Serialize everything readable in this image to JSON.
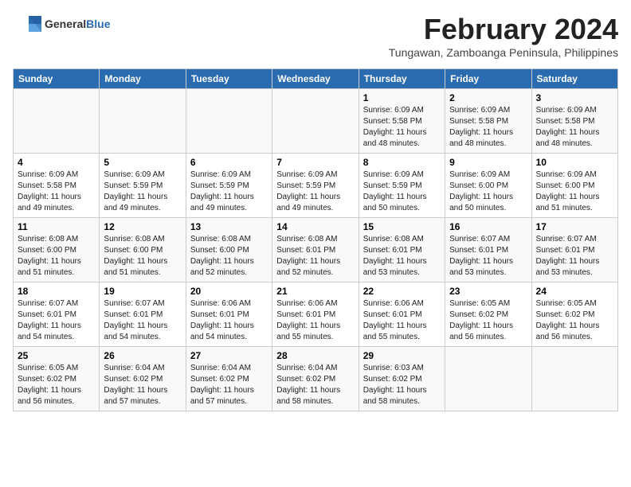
{
  "header": {
    "logo_general": "General",
    "logo_blue": "Blue",
    "month_title": "February 2024",
    "subtitle": "Tungawan, Zamboanga Peninsula, Philippines"
  },
  "columns": [
    "Sunday",
    "Monday",
    "Tuesday",
    "Wednesday",
    "Thursday",
    "Friday",
    "Saturday"
  ],
  "weeks": [
    [
      {
        "day": "",
        "info": ""
      },
      {
        "day": "",
        "info": ""
      },
      {
        "day": "",
        "info": ""
      },
      {
        "day": "",
        "info": ""
      },
      {
        "day": "1",
        "info": "Sunrise: 6:09 AM\nSunset: 5:58 PM\nDaylight: 11 hours and 48 minutes."
      },
      {
        "day": "2",
        "info": "Sunrise: 6:09 AM\nSunset: 5:58 PM\nDaylight: 11 hours and 48 minutes."
      },
      {
        "day": "3",
        "info": "Sunrise: 6:09 AM\nSunset: 5:58 PM\nDaylight: 11 hours and 48 minutes."
      }
    ],
    [
      {
        "day": "4",
        "info": "Sunrise: 6:09 AM\nSunset: 5:58 PM\nDaylight: 11 hours and 49 minutes."
      },
      {
        "day": "5",
        "info": "Sunrise: 6:09 AM\nSunset: 5:59 PM\nDaylight: 11 hours and 49 minutes."
      },
      {
        "day": "6",
        "info": "Sunrise: 6:09 AM\nSunset: 5:59 PM\nDaylight: 11 hours and 49 minutes."
      },
      {
        "day": "7",
        "info": "Sunrise: 6:09 AM\nSunset: 5:59 PM\nDaylight: 11 hours and 49 minutes."
      },
      {
        "day": "8",
        "info": "Sunrise: 6:09 AM\nSunset: 5:59 PM\nDaylight: 11 hours and 50 minutes."
      },
      {
        "day": "9",
        "info": "Sunrise: 6:09 AM\nSunset: 6:00 PM\nDaylight: 11 hours and 50 minutes."
      },
      {
        "day": "10",
        "info": "Sunrise: 6:09 AM\nSunset: 6:00 PM\nDaylight: 11 hours and 51 minutes."
      }
    ],
    [
      {
        "day": "11",
        "info": "Sunrise: 6:08 AM\nSunset: 6:00 PM\nDaylight: 11 hours and 51 minutes."
      },
      {
        "day": "12",
        "info": "Sunrise: 6:08 AM\nSunset: 6:00 PM\nDaylight: 11 hours and 51 minutes."
      },
      {
        "day": "13",
        "info": "Sunrise: 6:08 AM\nSunset: 6:00 PM\nDaylight: 11 hours and 52 minutes."
      },
      {
        "day": "14",
        "info": "Sunrise: 6:08 AM\nSunset: 6:01 PM\nDaylight: 11 hours and 52 minutes."
      },
      {
        "day": "15",
        "info": "Sunrise: 6:08 AM\nSunset: 6:01 PM\nDaylight: 11 hours and 53 minutes."
      },
      {
        "day": "16",
        "info": "Sunrise: 6:07 AM\nSunset: 6:01 PM\nDaylight: 11 hours and 53 minutes."
      },
      {
        "day": "17",
        "info": "Sunrise: 6:07 AM\nSunset: 6:01 PM\nDaylight: 11 hours and 53 minutes."
      }
    ],
    [
      {
        "day": "18",
        "info": "Sunrise: 6:07 AM\nSunset: 6:01 PM\nDaylight: 11 hours and 54 minutes."
      },
      {
        "day": "19",
        "info": "Sunrise: 6:07 AM\nSunset: 6:01 PM\nDaylight: 11 hours and 54 minutes."
      },
      {
        "day": "20",
        "info": "Sunrise: 6:06 AM\nSunset: 6:01 PM\nDaylight: 11 hours and 54 minutes."
      },
      {
        "day": "21",
        "info": "Sunrise: 6:06 AM\nSunset: 6:01 PM\nDaylight: 11 hours and 55 minutes."
      },
      {
        "day": "22",
        "info": "Sunrise: 6:06 AM\nSunset: 6:01 PM\nDaylight: 11 hours and 55 minutes."
      },
      {
        "day": "23",
        "info": "Sunrise: 6:05 AM\nSunset: 6:02 PM\nDaylight: 11 hours and 56 minutes."
      },
      {
        "day": "24",
        "info": "Sunrise: 6:05 AM\nSunset: 6:02 PM\nDaylight: 11 hours and 56 minutes."
      }
    ],
    [
      {
        "day": "25",
        "info": "Sunrise: 6:05 AM\nSunset: 6:02 PM\nDaylight: 11 hours and 56 minutes."
      },
      {
        "day": "26",
        "info": "Sunrise: 6:04 AM\nSunset: 6:02 PM\nDaylight: 11 hours and 57 minutes."
      },
      {
        "day": "27",
        "info": "Sunrise: 6:04 AM\nSunset: 6:02 PM\nDaylight: 11 hours and 57 minutes."
      },
      {
        "day": "28",
        "info": "Sunrise: 6:04 AM\nSunset: 6:02 PM\nDaylight: 11 hours and 58 minutes."
      },
      {
        "day": "29",
        "info": "Sunrise: 6:03 AM\nSunset: 6:02 PM\nDaylight: 11 hours and 58 minutes."
      },
      {
        "day": "",
        "info": ""
      },
      {
        "day": "",
        "info": ""
      }
    ]
  ]
}
